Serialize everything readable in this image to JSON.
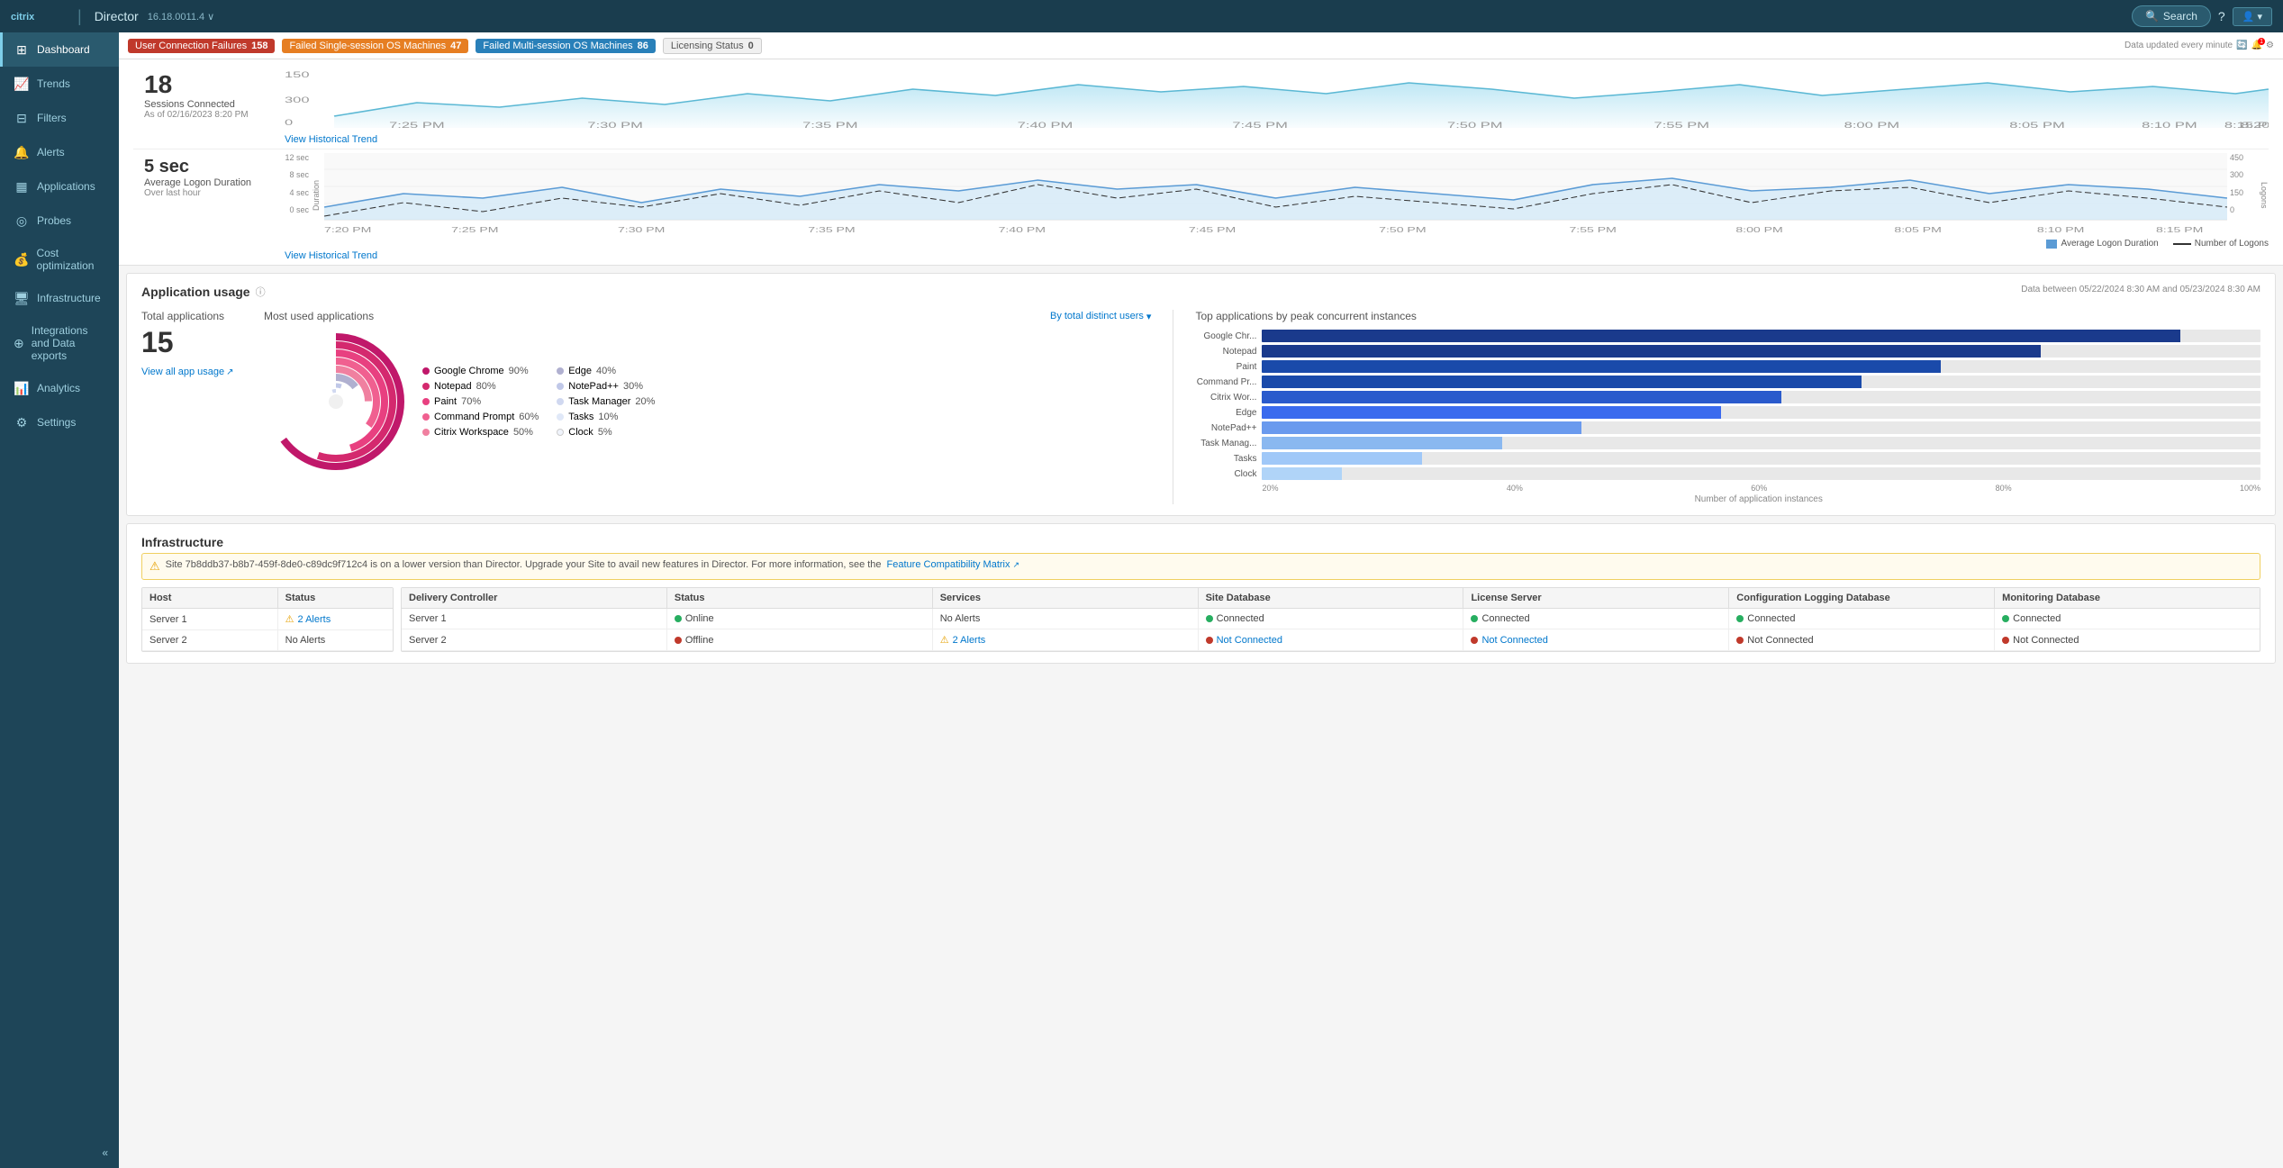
{
  "topNav": {
    "citrixLabel": "citrix",
    "directorLabel": "Director",
    "divider": "|",
    "breadcrumb": "16.18.0011.4 ∨",
    "searchLabel": "Search",
    "helpLabel": "?",
    "userLabel": "User"
  },
  "alerts": {
    "userConnectionFailures": {
      "label": "User Connection Failures",
      "count": "158",
      "color": "red"
    },
    "failedSingleSession": {
      "label": "Failed Single-session OS Machines",
      "count": "47",
      "color": "orange"
    },
    "failedMultiSession": {
      "label": "Failed Multi-session OS Machines",
      "count": "86",
      "color": "blue"
    },
    "licensingStatus": {
      "label": "Licensing Status",
      "count": "0",
      "color": "gray"
    },
    "dataUpdate": "Data updated every minute",
    "notifCount": "1"
  },
  "sidebar": {
    "items": [
      {
        "id": "dashboard",
        "label": "Dashboard",
        "icon": "⊞",
        "active": true
      },
      {
        "id": "trends",
        "label": "Trends",
        "icon": "📈"
      },
      {
        "id": "filters",
        "label": "Filters",
        "icon": "⊟"
      },
      {
        "id": "alerts",
        "label": "Alerts",
        "icon": "🔔"
      },
      {
        "id": "applications",
        "label": "Applications",
        "icon": "▦"
      },
      {
        "id": "probes",
        "label": "Probes",
        "icon": "◎"
      },
      {
        "id": "costOptimization",
        "label": "Cost optimization",
        "icon": "💰"
      },
      {
        "id": "infrastructure",
        "label": "Infrastructure",
        "icon": "🖥"
      },
      {
        "id": "integrations",
        "label": "Integrations and Data exports",
        "icon": "⊕"
      },
      {
        "id": "analytics",
        "label": "Analytics",
        "icon": "📊"
      },
      {
        "id": "settings",
        "label": "Settings",
        "icon": "⚙"
      }
    ],
    "collapseIcon": "«"
  },
  "sessionsChart": {
    "count": "18",
    "label": "Sessions Connected",
    "timestamp": "As of 02/16/2023 8:20 PM",
    "viewTrendLabel": "View Historical Trend"
  },
  "logonChart": {
    "value": "5 sec",
    "label": "Average Logon Duration",
    "sublabel": "Over last hour",
    "viewTrendLabel": "View Historical Trend",
    "legendAvgLogon": "Average Logon Duration",
    "legendNumLogons": "Number of Logons",
    "yLabels": [
      "12 sec",
      "8 sec",
      "4 sec",
      "0 sec"
    ],
    "rightYLabels": [
      "450",
      "300",
      "150",
      "0"
    ],
    "xLabels": [
      "7:20 PM",
      "7:25 PM",
      "7:30 PM",
      "7:35 PM",
      "7:40 PM",
      "7:45 PM",
      "7:50 PM",
      "7:55 PM",
      "8:00 PM",
      "8:05 PM",
      "8:10 PM",
      "8:15 PM"
    ],
    "durationLabel": "Duration",
    "logonsLabel": "Logons"
  },
  "appUsage": {
    "title": "Application usage",
    "dateRange": "Data between 05/22/2024 8:30 AM and 05/23/2024 8:30 AM",
    "totalLabel": "Total applications",
    "totalCount": "15",
    "viewAllLabel": "View all app usage",
    "mostUsedTitle": "Most used applications",
    "filterLabel": "By total distinct users",
    "topByInstancesTitle": "Top applications by peak concurrent instances",
    "donutItems": [
      {
        "label": "Google Chrome",
        "pct": "90%",
        "color": "#c0186a"
      },
      {
        "label": "Notepad",
        "pct": "80%",
        "color": "#d4296e"
      },
      {
        "label": "Paint",
        "pct": "70%",
        "color": "#e84080"
      },
      {
        "label": "Command Prompt",
        "pct": "60%",
        "color": "#f06090"
      },
      {
        "label": "Citrix Workspace",
        "pct": "50%",
        "color": "#f080a0"
      },
      {
        "label": "Edge",
        "pct": "40%",
        "color": "#b0b0d0"
      },
      {
        "label": "NotePad++",
        "pct": "30%",
        "color": "#c0c8e8"
      },
      {
        "label": "Task Manager",
        "pct": "20%",
        "color": "#d0d8f0"
      },
      {
        "label": "Tasks",
        "pct": "10%",
        "color": "#e0e8f8"
      },
      {
        "label": "Clock",
        "pct": "5%",
        "color": "#f0f4fc"
      }
    ],
    "barItems": [
      {
        "label": "Google Chr...",
        "pct": 92,
        "color": "#1a3a8c"
      },
      {
        "label": "Notepad",
        "pct": 78,
        "color": "#1a3a8c"
      },
      {
        "label": "Paint",
        "pct": 68,
        "color": "#1a4aaa"
      },
      {
        "label": "Command Pr...",
        "pct": 60,
        "color": "#1a4aaa"
      },
      {
        "label": "Citrix Wor...",
        "pct": 52,
        "color": "#2a5acc"
      },
      {
        "label": "Edge",
        "pct": 46,
        "color": "#3a6aee"
      },
      {
        "label": "NotePad++",
        "pct": 32,
        "color": "#6a9aee"
      },
      {
        "label": "Task Manag...",
        "pct": 24,
        "color": "#8ab8f0"
      },
      {
        "label": "Tasks",
        "pct": 16,
        "color": "#a0c8f8"
      },
      {
        "label": "Clock",
        "pct": 8,
        "color": "#b0d4f8"
      }
    ],
    "barXLabels": [
      "20%",
      "40%",
      "60%",
      "80%",
      "100%"
    ],
    "barXAxisTitle": "Number of application instances"
  },
  "infrastructure": {
    "title": "Infrastructure",
    "warningText": "Site 7b8ddb37-b8b7-459f-8de0-c89dc9f712c4 is on a lower version than Director. Upgrade your Site to avail new features in Director. For more information, see the",
    "featureMatrixLink": "Feature Compatibility Matrix",
    "hostTable": {
      "headers": [
        "Host",
        "Status"
      ],
      "rows": [
        {
          "host": "Server 1",
          "status": "2 Alerts",
          "statusType": "warning"
        },
        {
          "host": "Server 2",
          "status": "No Alerts",
          "statusType": "ok"
        }
      ]
    },
    "deliveryTable": {
      "headers": [
        "Delivery Controller",
        "Status",
        "Services",
        "Site Database",
        "License Server",
        "Configuration Logging Database",
        "Monitoring Database"
      ],
      "rows": [
        {
          "controller": "Server 1",
          "status": "Online",
          "statusType": "green",
          "services": "No Alerts",
          "servicesType": "ok",
          "siteDb": "Connected",
          "siteDbType": "green",
          "licenseServer": "Connected",
          "licenseType": "green",
          "configLogging": "Connected",
          "configType": "green",
          "monitoring": "Connected",
          "monitoringType": "green"
        },
        {
          "controller": "Server 2",
          "status": "Offline",
          "statusType": "red",
          "services": "2 Alerts",
          "servicesType": "warning",
          "siteDb": "Not Connected",
          "siteDbType": "red",
          "licenseServer": "Not Connected",
          "licenseType": "red",
          "configLogging": "Not Connected",
          "configType": "red",
          "monitoring": "Not Connected",
          "monitoringType": "red"
        }
      ]
    }
  }
}
